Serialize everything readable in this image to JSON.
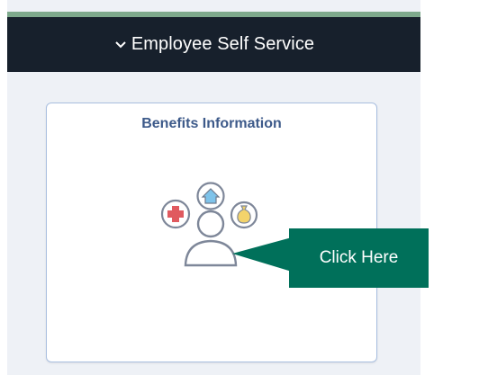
{
  "header": {
    "title": "Employee Self Service",
    "chevron_icon": "chevron-down-icon"
  },
  "tile": {
    "title": "Benefits Information",
    "icon": "benefits-person-icon",
    "icons": [
      "medical-cross-icon",
      "home-icon",
      "money-bag-icon",
      "person-icon"
    ]
  },
  "callout": {
    "label": "Click Here",
    "color": "#00705a"
  },
  "colors": {
    "header_bg": "#17202c",
    "accent_strip": "#7ea98c",
    "panel_bg": "#eef1f6",
    "tile_border": "#a9bfe0",
    "tile_title": "#3d5a8a"
  }
}
